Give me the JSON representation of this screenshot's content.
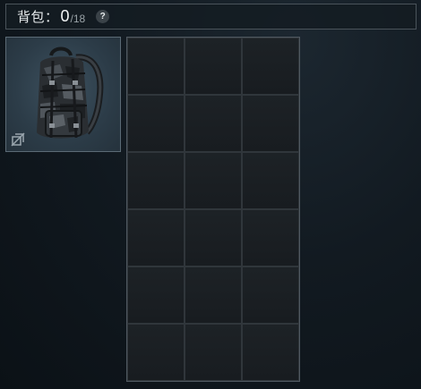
{
  "header": {
    "label": "背包：",
    "current_count": "0",
    "separator": "/",
    "max_count": "18",
    "help_glyph": "?"
  },
  "equipped_slot": {
    "item_icon": "tactical-backpack-icon",
    "badge_icon": "unbound-tag-icon"
  },
  "inventory": {
    "columns": 3,
    "rows": 6,
    "capacity": 18,
    "used": 0
  },
  "colors": {
    "background": "#121a21",
    "panel_border": "#4a535a",
    "slot_highlight": "#3e5260",
    "cell_fill": "#1b2024"
  }
}
